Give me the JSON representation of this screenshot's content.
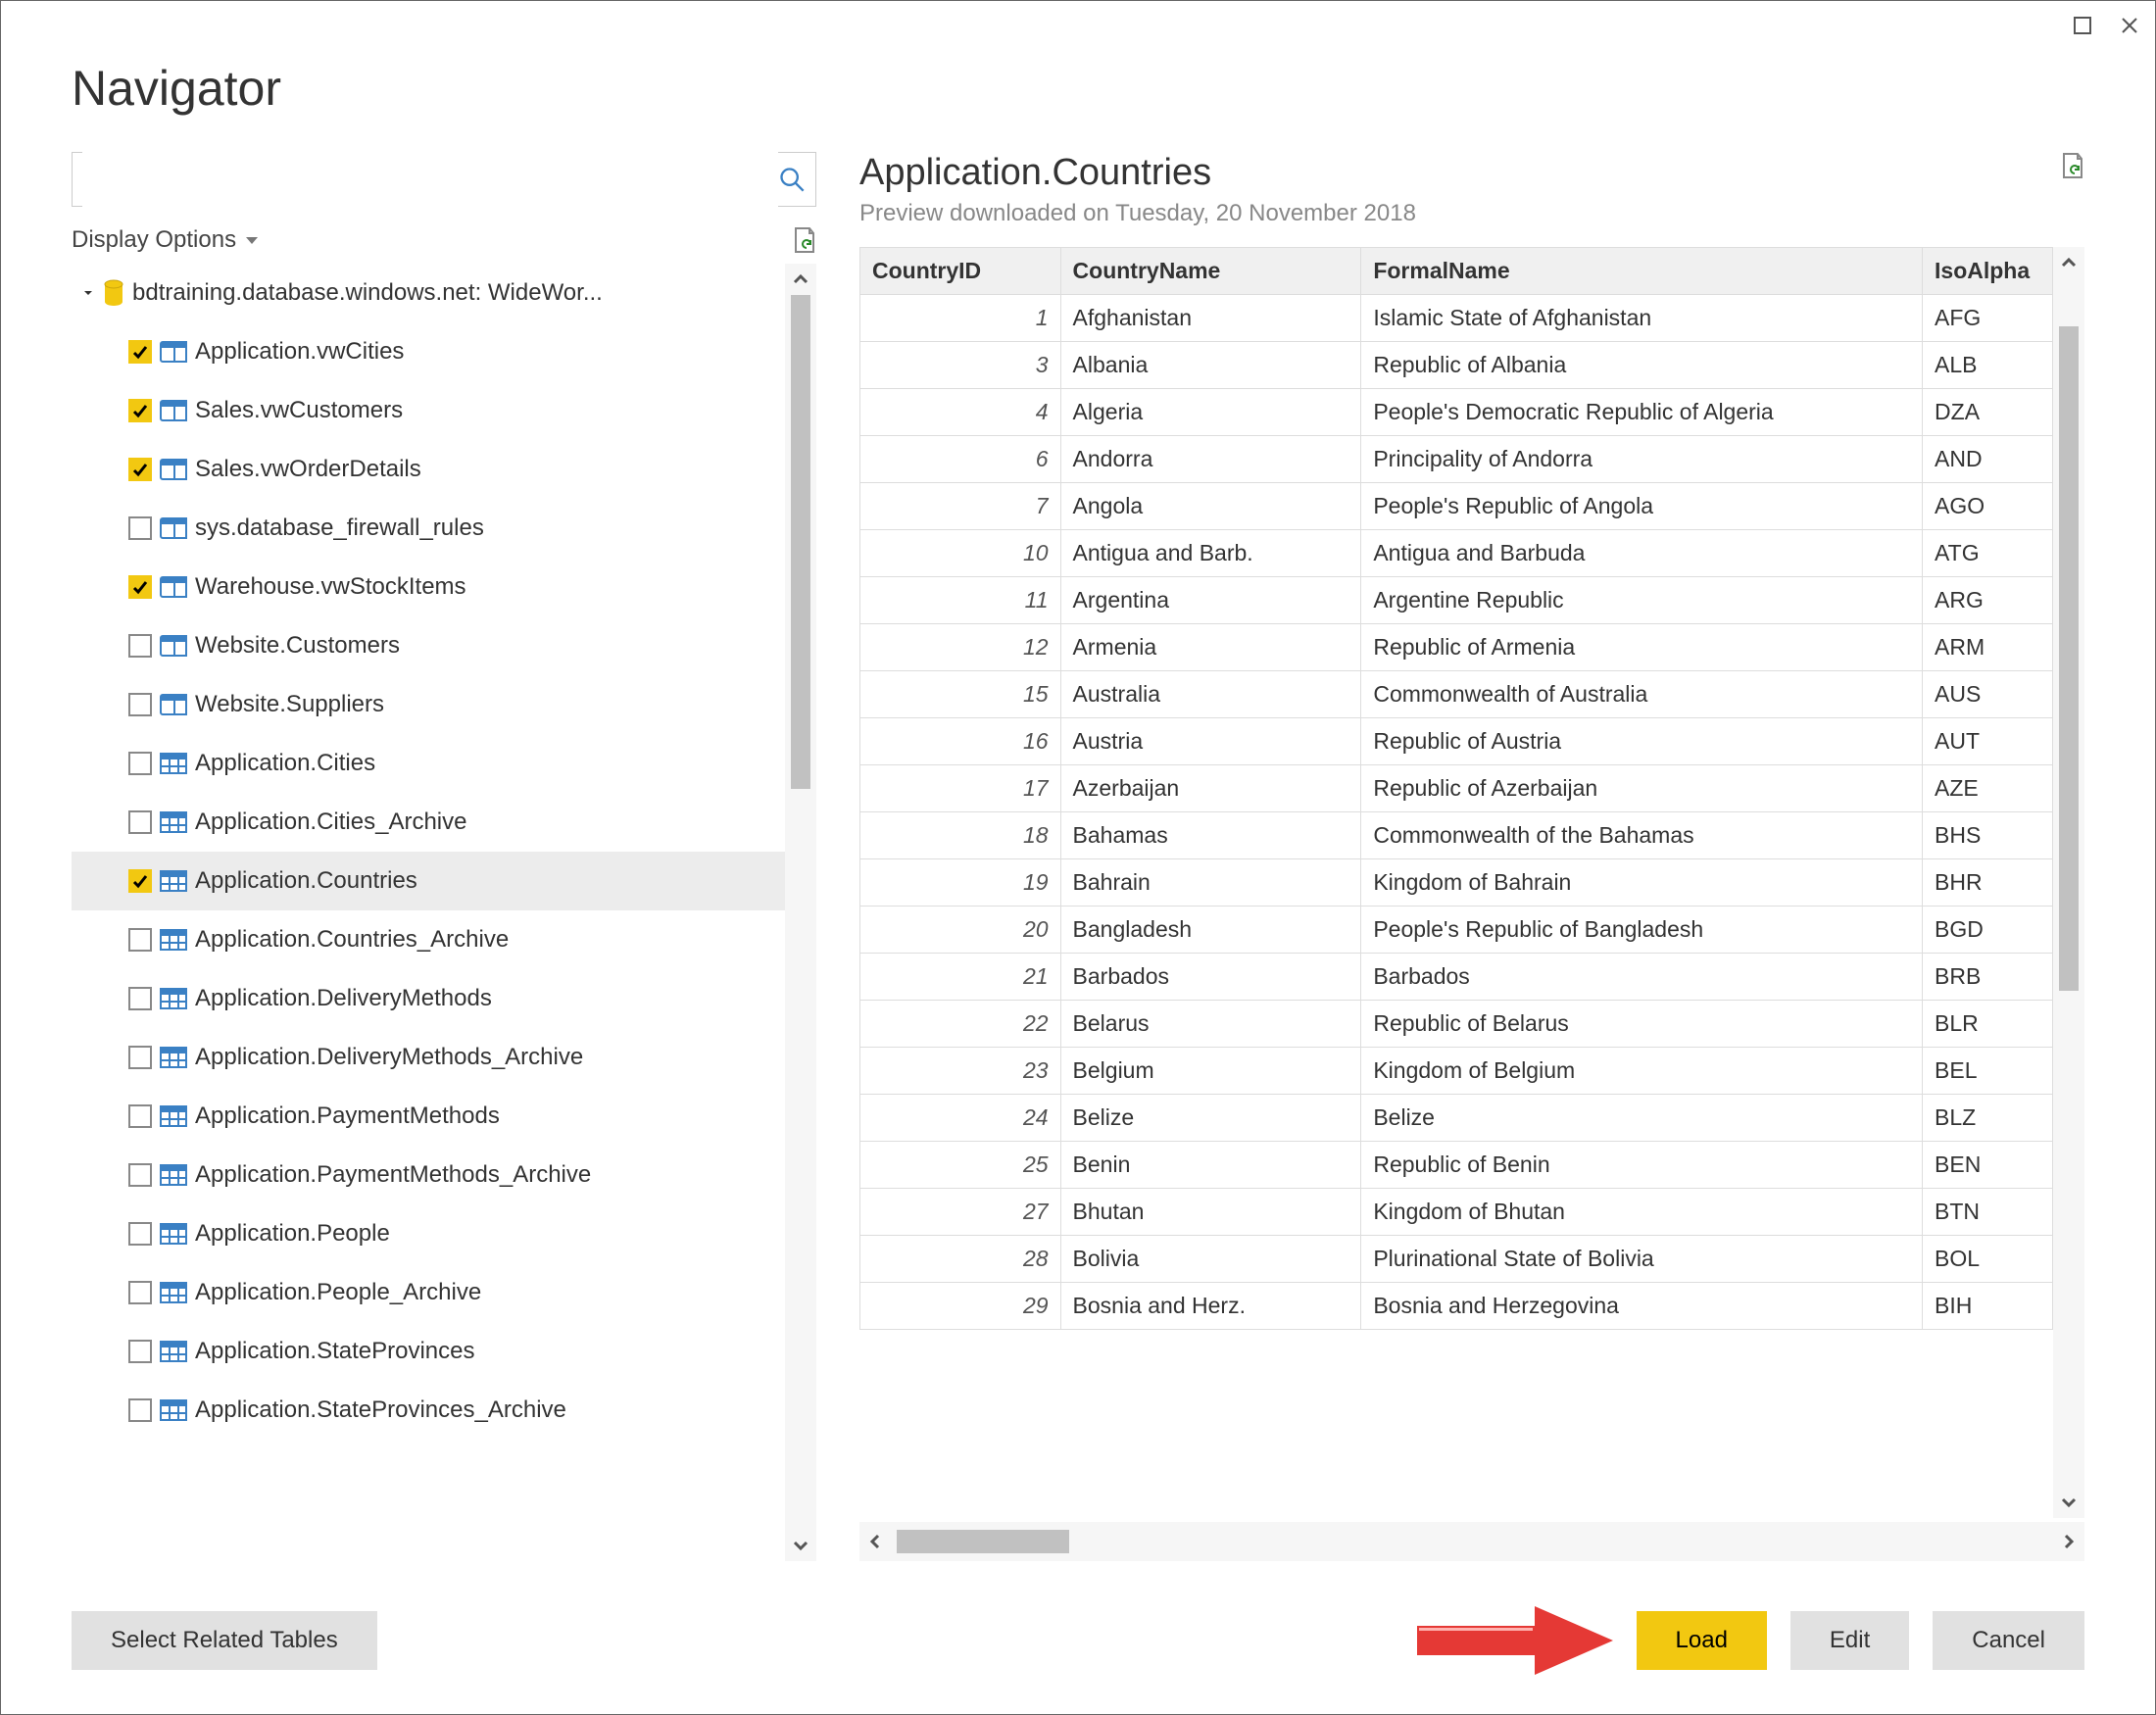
{
  "window": {
    "title": "Navigator"
  },
  "search": {
    "placeholder": ""
  },
  "display_options": {
    "label": "Display Options"
  },
  "tree": {
    "root": {
      "label": "bdtraining.database.windows.net: WideWor..."
    },
    "items": [
      {
        "label": "Application.vwCities",
        "checked": true,
        "icon": "view"
      },
      {
        "label": "Sales.vwCustomers",
        "checked": true,
        "icon": "view"
      },
      {
        "label": "Sales.vwOrderDetails",
        "checked": true,
        "icon": "view"
      },
      {
        "label": "sys.database_firewall_rules",
        "checked": false,
        "icon": "view"
      },
      {
        "label": "Warehouse.vwStockItems",
        "checked": true,
        "icon": "view"
      },
      {
        "label": "Website.Customers",
        "checked": false,
        "icon": "view"
      },
      {
        "label": "Website.Suppliers",
        "checked": false,
        "icon": "view"
      },
      {
        "label": "Application.Cities",
        "checked": false,
        "icon": "table"
      },
      {
        "label": "Application.Cities_Archive",
        "checked": false,
        "icon": "table"
      },
      {
        "label": "Application.Countries",
        "checked": true,
        "icon": "table",
        "selected": true
      },
      {
        "label": "Application.Countries_Archive",
        "checked": false,
        "icon": "table"
      },
      {
        "label": "Application.DeliveryMethods",
        "checked": false,
        "icon": "table"
      },
      {
        "label": "Application.DeliveryMethods_Archive",
        "checked": false,
        "icon": "table"
      },
      {
        "label": "Application.PaymentMethods",
        "checked": false,
        "icon": "table"
      },
      {
        "label": "Application.PaymentMethods_Archive",
        "checked": false,
        "icon": "table"
      },
      {
        "label": "Application.People",
        "checked": false,
        "icon": "table"
      },
      {
        "label": "Application.People_Archive",
        "checked": false,
        "icon": "table"
      },
      {
        "label": "Application.StateProvinces",
        "checked": false,
        "icon": "table"
      },
      {
        "label": "Application.StateProvinces_Archive",
        "checked": false,
        "icon": "table"
      }
    ]
  },
  "preview": {
    "title": "Application.Countries",
    "subtitle": "Preview downloaded on Tuesday, 20 November 2018",
    "columns": [
      "CountryID",
      "CountryName",
      "FormalName",
      "IsoAlpha"
    ],
    "col4_display": "IsoAlpha",
    "rows": [
      {
        "id": 1,
        "name": "Afghanistan",
        "formal": "Islamic State of Afghanistan",
        "iso": "AFG"
      },
      {
        "id": 3,
        "name": "Albania",
        "formal": "Republic of Albania",
        "iso": "ALB"
      },
      {
        "id": 4,
        "name": "Algeria",
        "formal": "People's Democratic Republic of Algeria",
        "iso": "DZA"
      },
      {
        "id": 6,
        "name": "Andorra",
        "formal": "Principality of Andorra",
        "iso": "AND"
      },
      {
        "id": 7,
        "name": "Angola",
        "formal": "People's Republic of Angola",
        "iso": "AGO"
      },
      {
        "id": 10,
        "name": "Antigua and Barb.",
        "formal": "Antigua and Barbuda",
        "iso": "ATG"
      },
      {
        "id": 11,
        "name": "Argentina",
        "formal": "Argentine Republic",
        "iso": "ARG"
      },
      {
        "id": 12,
        "name": "Armenia",
        "formal": "Republic of Armenia",
        "iso": "ARM"
      },
      {
        "id": 15,
        "name": "Australia",
        "formal": "Commonwealth of Australia",
        "iso": "AUS"
      },
      {
        "id": 16,
        "name": "Austria",
        "formal": "Republic of Austria",
        "iso": "AUT"
      },
      {
        "id": 17,
        "name": "Azerbaijan",
        "formal": "Republic of Azerbaijan",
        "iso": "AZE"
      },
      {
        "id": 18,
        "name": "Bahamas",
        "formal": "Commonwealth of the Bahamas",
        "iso": "BHS"
      },
      {
        "id": 19,
        "name": "Bahrain",
        "formal": "Kingdom of Bahrain",
        "iso": "BHR"
      },
      {
        "id": 20,
        "name": "Bangladesh",
        "formal": "People's Republic of Bangladesh",
        "iso": "BGD"
      },
      {
        "id": 21,
        "name": "Barbados",
        "formal": "Barbados",
        "iso": "BRB"
      },
      {
        "id": 22,
        "name": "Belarus",
        "formal": "Republic of Belarus",
        "iso": "BLR"
      },
      {
        "id": 23,
        "name": "Belgium",
        "formal": "Kingdom of Belgium",
        "iso": "BEL"
      },
      {
        "id": 24,
        "name": "Belize",
        "formal": "Belize",
        "iso": "BLZ"
      },
      {
        "id": 25,
        "name": "Benin",
        "formal": "Republic of Benin",
        "iso": "BEN"
      },
      {
        "id": 27,
        "name": "Bhutan",
        "formal": "Kingdom of Bhutan",
        "iso": "BTN"
      },
      {
        "id": 28,
        "name": "Bolivia",
        "formal": "Plurinational State of Bolivia",
        "iso": "BOL"
      },
      {
        "id": 29,
        "name": "Bosnia and Herz.",
        "formal": "Bosnia and Herzegovina",
        "iso": "BIH"
      }
    ]
  },
  "footer": {
    "select_related": "Select Related Tables",
    "load": "Load",
    "edit": "Edit",
    "cancel": "Cancel"
  }
}
